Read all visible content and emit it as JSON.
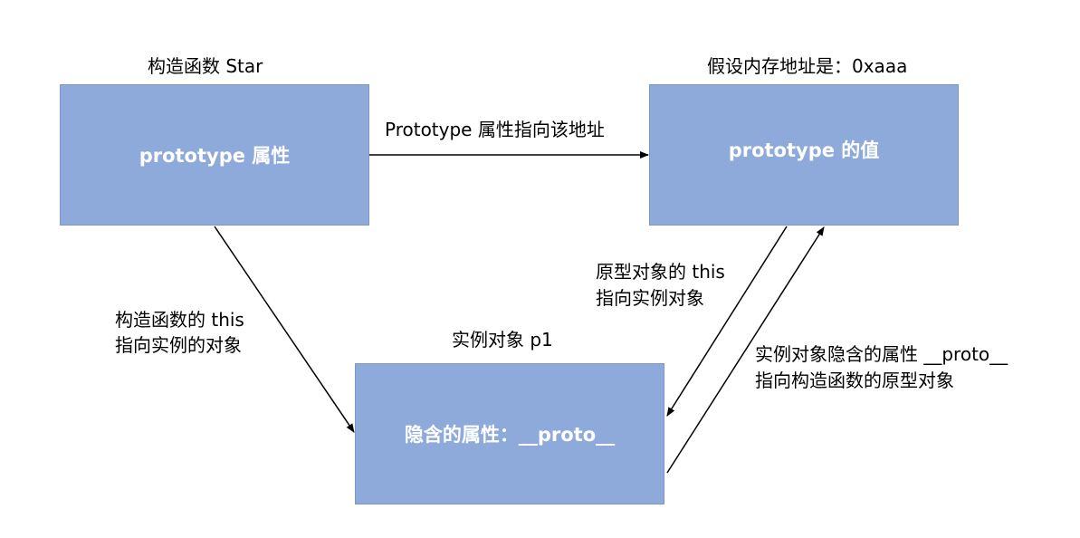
{
  "colors": {
    "box_fill": "#8eaadb",
    "box_text": "#ffffff",
    "line": "#000000"
  },
  "boxes": {
    "star": {
      "title": "构造函数 Star",
      "content": "prototype 属性"
    },
    "prototype": {
      "title": "假设内存地址是：0xaaa",
      "content": "prototype 的值"
    },
    "instance": {
      "title": "实例对象 p1",
      "content": "隐含的属性：__proto__"
    }
  },
  "edges": {
    "star_to_prototype": "Prototype 属性指向该地址",
    "constructor_this": {
      "line1": "构造函数的 this",
      "line2": "指向实例的对象"
    },
    "prototype_this": {
      "line1": "原型对象的 this",
      "line2": "指向实例对象"
    },
    "proto_link": {
      "line1": "实例对象隐含的属性 __proto__",
      "line2": "指向构造函数的原型对象"
    }
  }
}
